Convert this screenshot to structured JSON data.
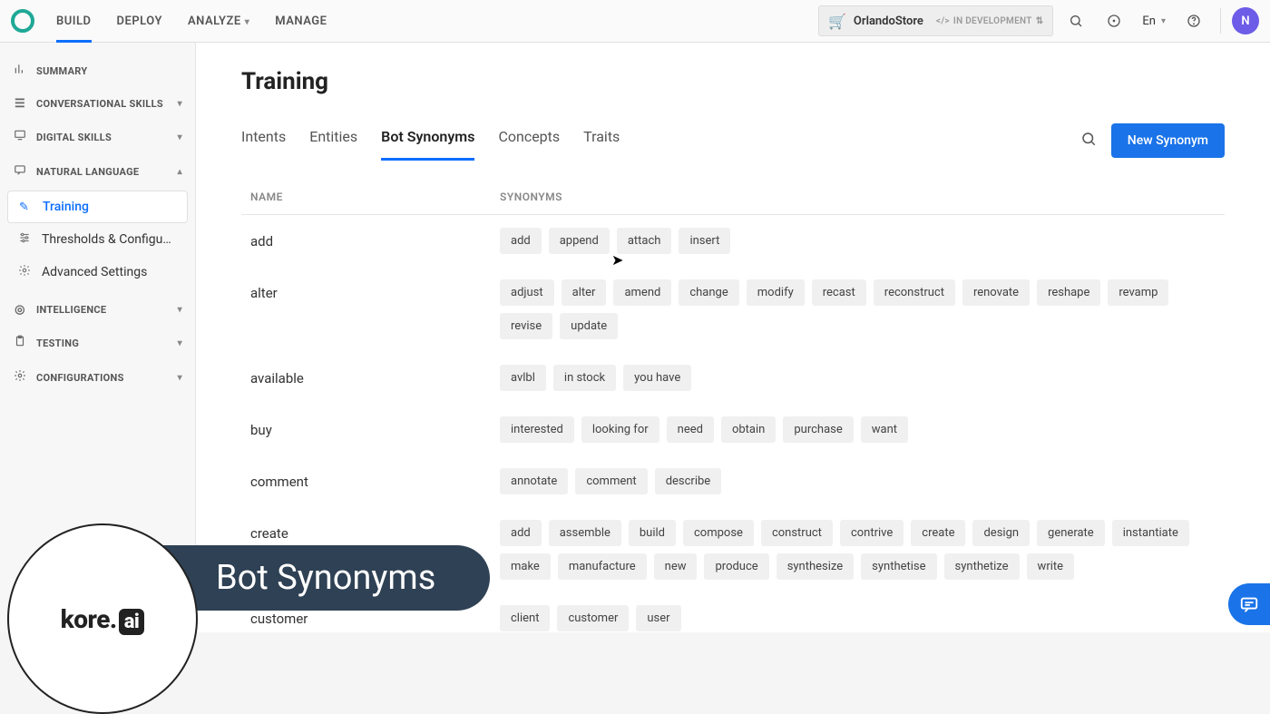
{
  "topnav": {
    "build": "BUILD",
    "deploy": "DEPLOY",
    "analyze": "ANALYZE",
    "manage": "MANAGE"
  },
  "header": {
    "store_name": "OrlandoStore",
    "dev_badge": "IN DEVELOPMENT",
    "language": "En"
  },
  "sidebar": {
    "summary": "SUMMARY",
    "conversational": "CONVERSATIONAL SKILLS",
    "digital": "DIGITAL SKILLS",
    "natural_language": "NATURAL LANGUAGE",
    "nl_items": {
      "training": "Training",
      "thresholds": "Thresholds & Configu…",
      "advanced": "Advanced Settings"
    },
    "intelligence": "INTELLIGENCE",
    "testing": "TESTING",
    "configurations": "CONFIGURATIONS"
  },
  "page": {
    "title": "Training",
    "tabs": {
      "intents": "Intents",
      "entities": "Entities",
      "bot_synonyms": "Bot Synonyms",
      "concepts": "Concepts",
      "traits": "Traits"
    },
    "new_btn": "New Synonym",
    "col_name": "NAME",
    "col_syn": "SYNONYMS"
  },
  "rows": [
    {
      "name": "add",
      "synonyms": [
        "add",
        "append",
        "attach",
        "insert"
      ]
    },
    {
      "name": "alter",
      "synonyms": [
        "adjust",
        "alter",
        "amend",
        "change",
        "modify",
        "recast",
        "reconstruct",
        "renovate",
        "reshape",
        "revamp",
        "revise",
        "update"
      ]
    },
    {
      "name": "available",
      "synonyms": [
        "avlbl",
        "in stock",
        "you have"
      ]
    },
    {
      "name": "buy",
      "synonyms": [
        "interested",
        "looking for",
        "need",
        "obtain",
        "purchase",
        "want"
      ]
    },
    {
      "name": "comment",
      "synonyms": [
        "annotate",
        "comment",
        "describe"
      ]
    },
    {
      "name": "create",
      "synonyms": [
        "add",
        "assemble",
        "build",
        "compose",
        "construct",
        "contrive",
        "create",
        "design",
        "generate",
        "instantiate",
        "make",
        "manufacture",
        "new",
        "produce",
        "synthesize",
        "synthetise",
        "synthetize",
        "write"
      ]
    },
    {
      "name": "customer",
      "synonyms": [
        "client",
        "customer",
        "user"
      ]
    }
  ],
  "banner": {
    "logo_text": "kore.",
    "logo_ai": "ai",
    "title": "Bot Synonyms"
  }
}
